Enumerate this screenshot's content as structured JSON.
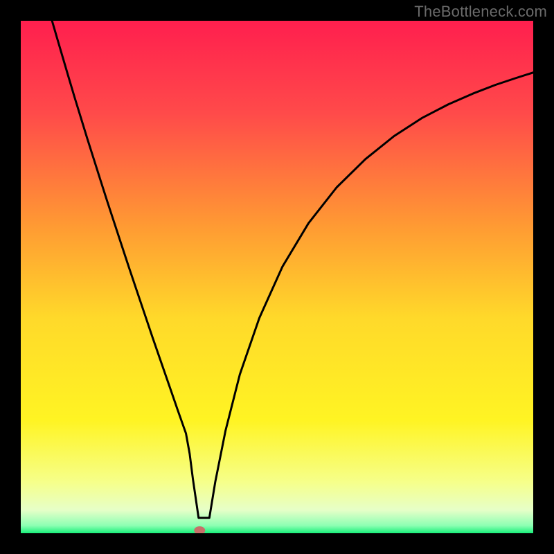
{
  "watermark": "TheBottleneck.com",
  "colors": {
    "curve_stroke": "#000000",
    "marker_fill": "#c77069",
    "gradient_stops": [
      {
        "offset": 0,
        "color": "#ff1f4e"
      },
      {
        "offset": 0.18,
        "color": "#ff4a4a"
      },
      {
        "offset": 0.4,
        "color": "#ff9a33"
      },
      {
        "offset": 0.58,
        "color": "#ffd92a"
      },
      {
        "offset": 0.78,
        "color": "#fff423"
      },
      {
        "offset": 0.9,
        "color": "#f6ff8a"
      },
      {
        "offset": 0.955,
        "color": "#e6ffc8"
      },
      {
        "offset": 0.985,
        "color": "#8dffb3"
      },
      {
        "offset": 1.0,
        "color": "#18f07a"
      }
    ]
  },
  "chart_data": {
    "type": "line",
    "title": "",
    "xlabel": "",
    "ylabel": "",
    "xlim": [
      0,
      100
    ],
    "ylim": [
      0,
      100
    ],
    "grid": false,
    "legend": null,
    "marker": {
      "x": 34.9,
      "y": 0.0
    },
    "series": [
      {
        "name": "bottleneck-curve",
        "x": [
          6.1,
          7.15,
          8.24,
          9.36,
          10.52,
          11.72,
          12.95,
          14.22,
          15.52,
          16.86,
          18.24,
          19.65,
          21.1,
          22.58,
          24.1,
          25.65,
          27.24,
          28.87,
          30.53,
          32.23,
          32.96,
          33.6,
          34.7,
          36.8,
          37.95,
          39.95,
          42.75,
          46.55,
          51.05,
          56.15,
          61.65,
          67.25,
          72.85,
          78.25,
          83.45,
          88.25,
          92.65,
          96.55,
          100.0
        ],
        "y": [
          100.0,
          96.4,
          92.7,
          88.9,
          85.0,
          81.1,
          77.1,
          73.1,
          69.0,
          64.8,
          60.6,
          56.3,
          51.9,
          47.5,
          43.0,
          38.4,
          33.8,
          29.1,
          24.3,
          19.5,
          15.5,
          10.5,
          3.0,
          3.0,
          10.0,
          20.0,
          31.0,
          42.0,
          52.0,
          60.5,
          67.5,
          73.0,
          77.5,
          81.0,
          83.7,
          85.8,
          87.5,
          88.8,
          89.9
        ]
      }
    ]
  }
}
